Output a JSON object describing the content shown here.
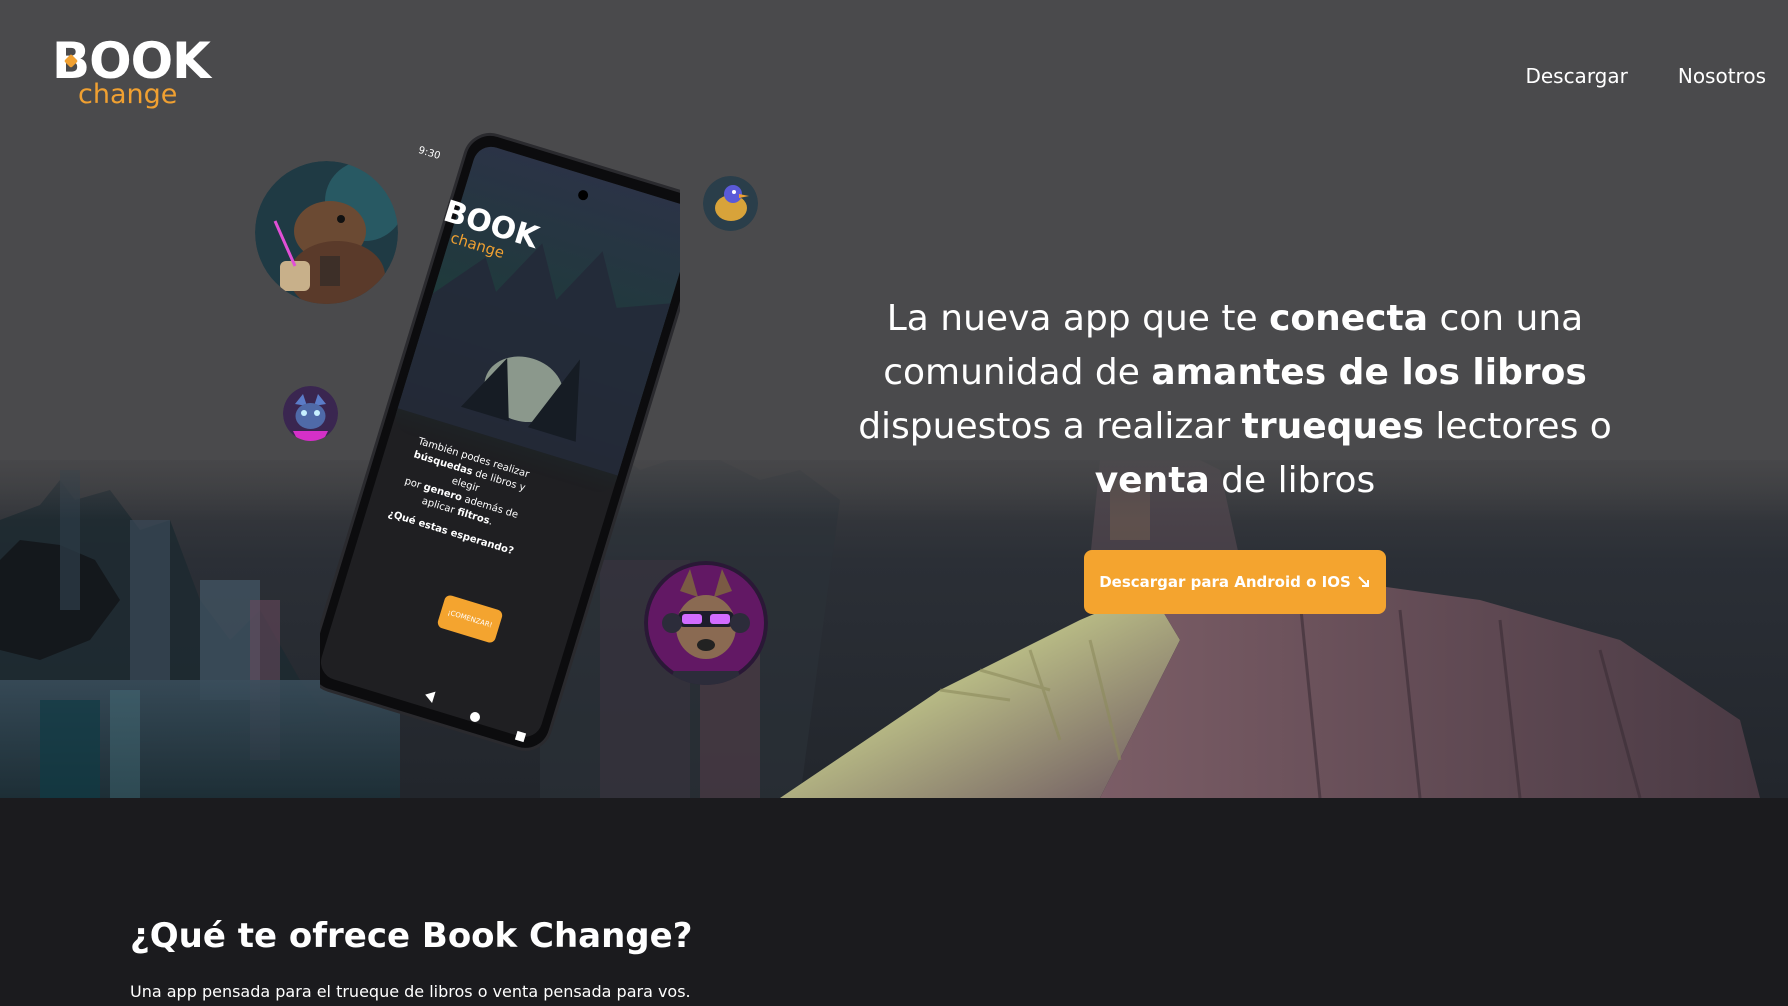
{
  "logo": {
    "word": "BOOK",
    "sub": "change"
  },
  "nav": [
    {
      "label": "Descargar"
    },
    {
      "label": "Nosotros"
    }
  ],
  "hero": {
    "headline_parts": [
      {
        "text": "La nueva app que te ",
        "bold": false
      },
      {
        "text": "conecta",
        "bold": true
      },
      {
        "text": " con una comunidad de ",
        "bold": false
      },
      {
        "text": "amantes de los libros",
        "bold": true
      },
      {
        "text": " dispuestos a realizar ",
        "bold": false
      },
      {
        "text": "trueques",
        "bold": true
      },
      {
        "text": " lectores o ",
        "bold": false
      },
      {
        "text": "venta",
        "bold": true
      },
      {
        "text": " de libros",
        "bold": false
      }
    ],
    "cta_label": "Descargar para Android o IOS",
    "cta_icon": "arrow-down-right-icon"
  },
  "phone": {
    "status_time": "9:30",
    "app_logo_word": "BOOK",
    "app_logo_sub": "change",
    "body_lines": [
      {
        "text": "También podes realizar",
        "bold": false
      },
      {
        "text": "búsquedas",
        "bold": true
      },
      {
        "text": " de libros y elegir",
        "bold": false
      },
      {
        "text": "por ",
        "bold": false
      },
      {
        "text": "genero",
        "bold": true
      },
      {
        "text": " además de",
        "bold": false
      },
      {
        "text": "aplicar ",
        "bold": false
      },
      {
        "text": "filtros",
        "bold": true
      },
      {
        "text": ".",
        "bold": false
      }
    ],
    "question": "¿Qué estas esperando?",
    "button_label": "¡COMENZAR!"
  },
  "section2": {
    "title": "¿Qué te ofrece Book Change?",
    "subtitle": "Una app pensada para el trueque de libros o venta pensada para vos."
  },
  "colors": {
    "accent": "#f4a42f",
    "dark": "#1b1b1e"
  }
}
